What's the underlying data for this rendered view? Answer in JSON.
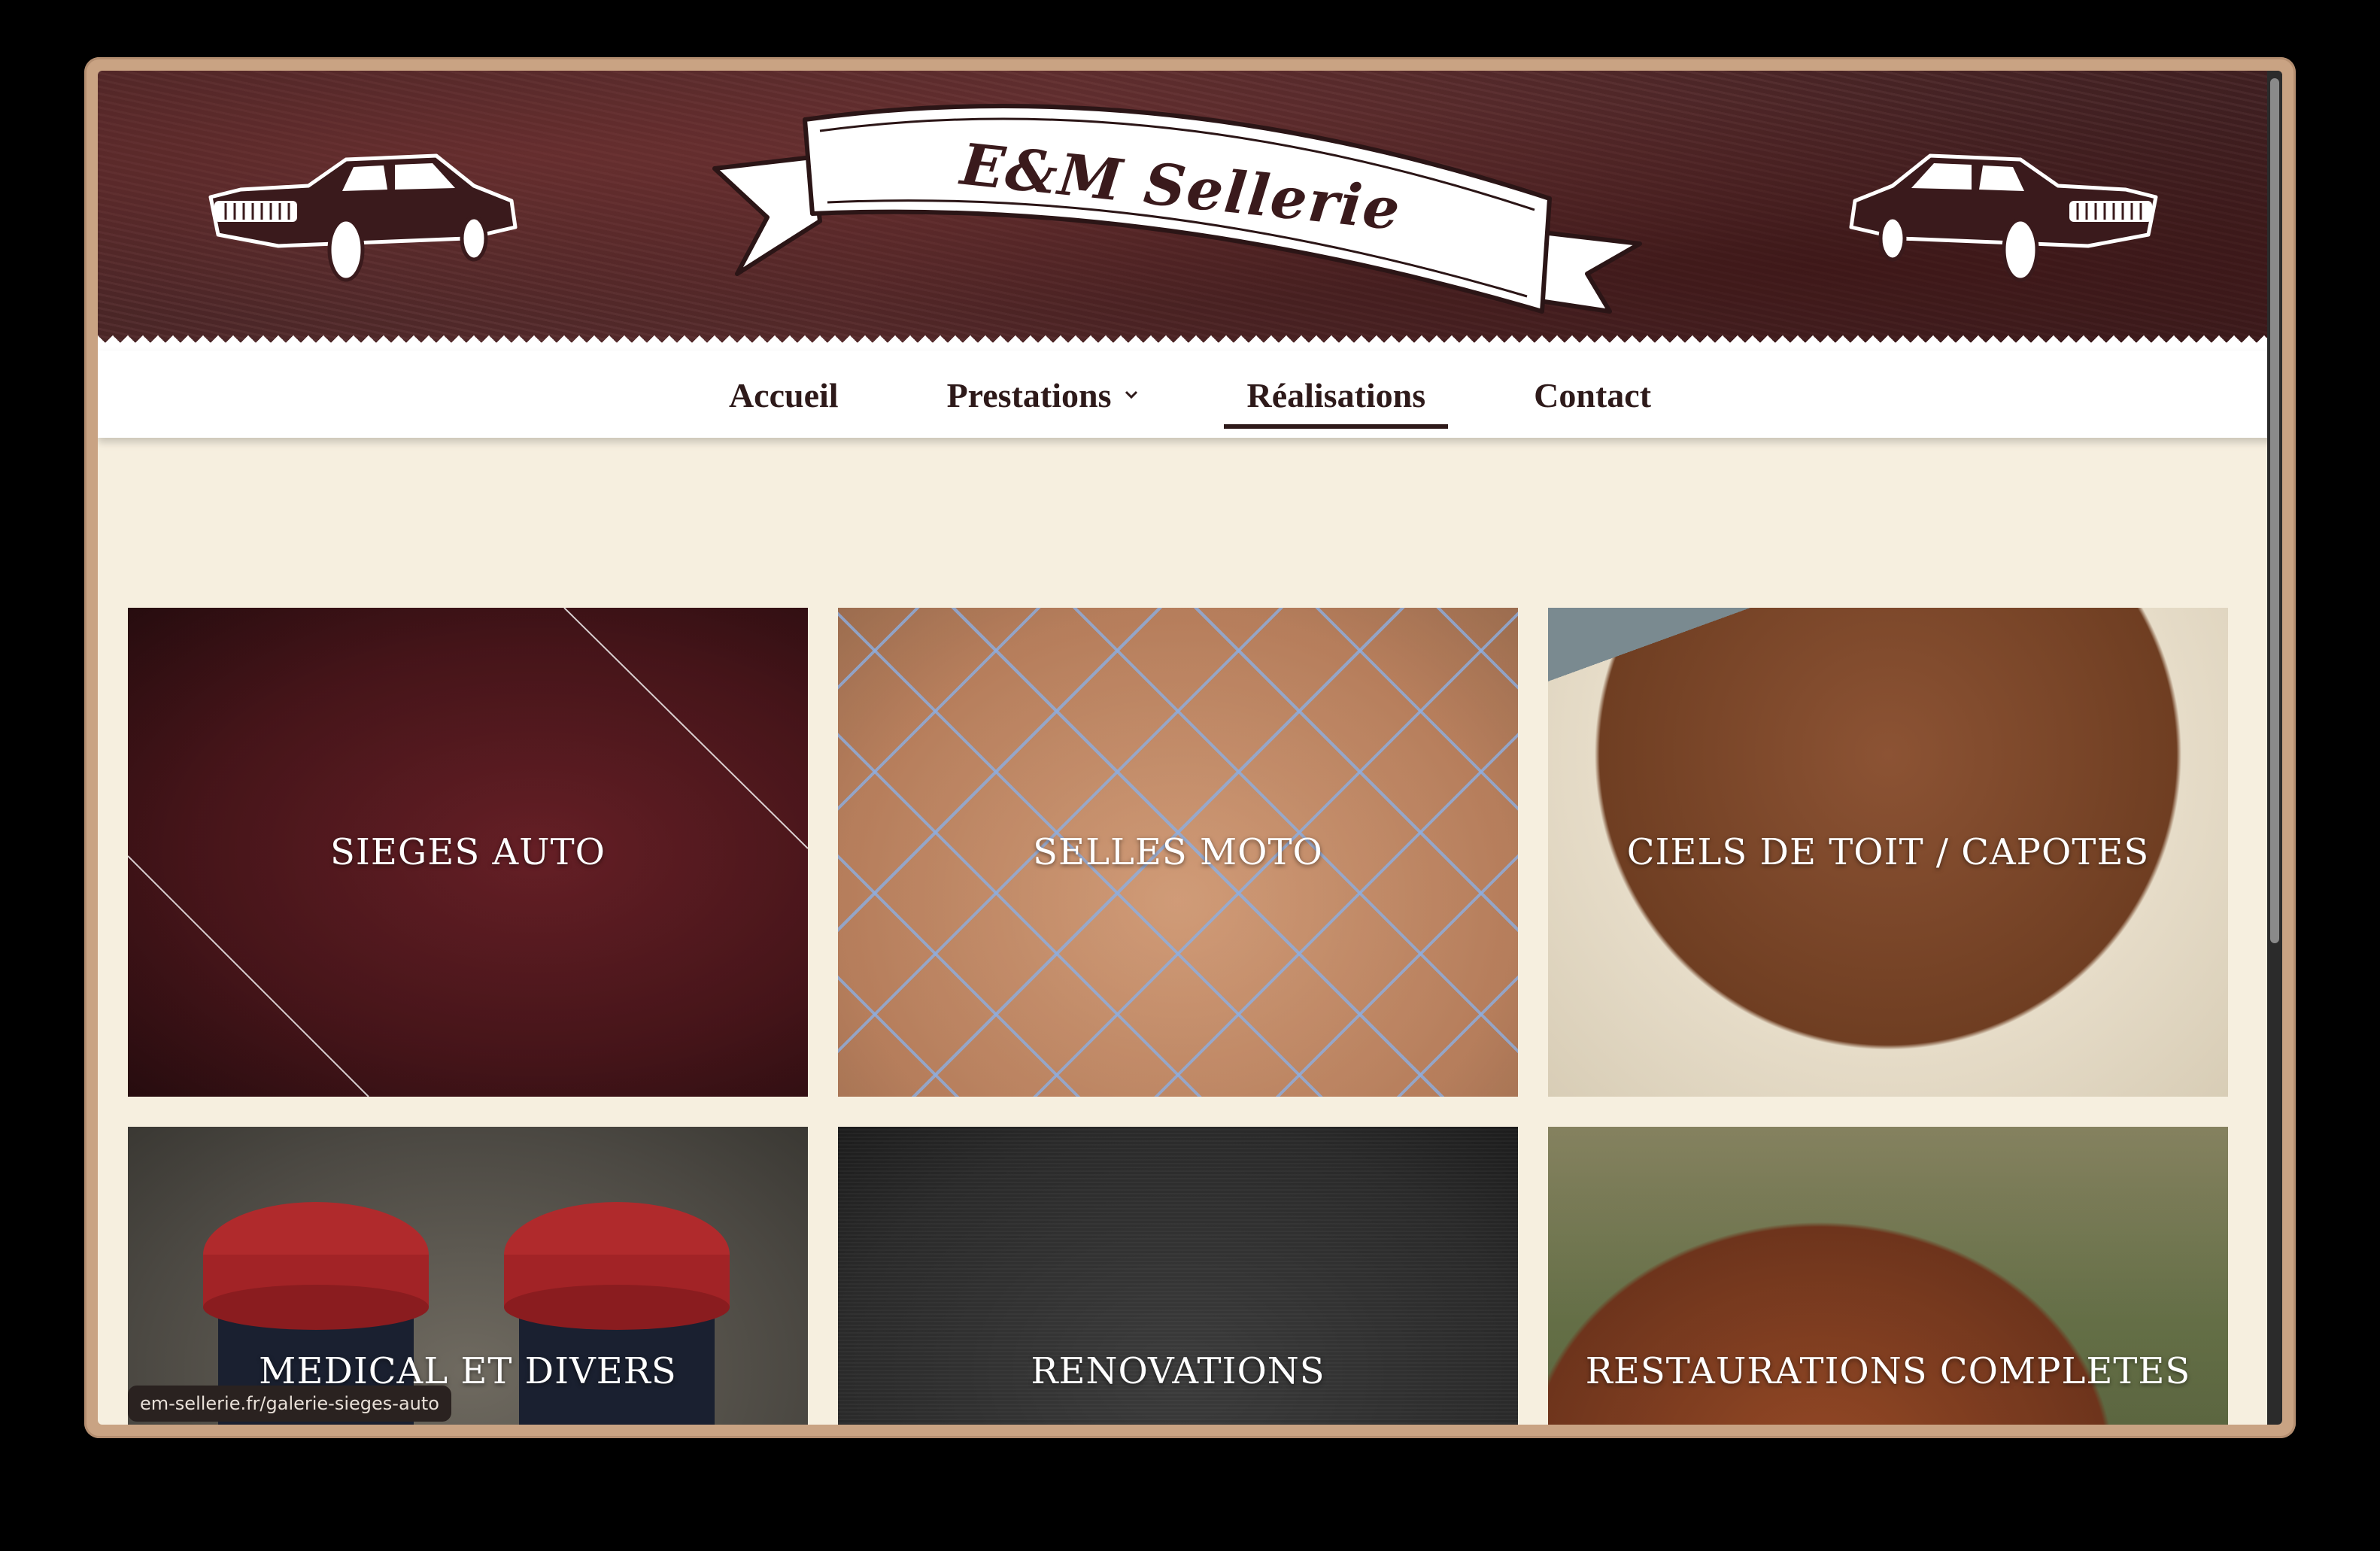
{
  "site": {
    "brand": "E&M Sellerie"
  },
  "nav": {
    "items": [
      {
        "label": "Accueil",
        "active": false,
        "dropdown": false
      },
      {
        "label": "Prestations",
        "active": false,
        "dropdown": true
      },
      {
        "label": "Réalisations",
        "active": true,
        "dropdown": false
      },
      {
        "label": "Contact",
        "active": false,
        "dropdown": false
      }
    ]
  },
  "gallery": {
    "tiles": [
      {
        "label": "SIEGES AUTO"
      },
      {
        "label": "SELLES MOTO"
      },
      {
        "label": "CIELS DE TOIT / CAPOTES"
      },
      {
        "label": "MEDICAL ET DIVERS"
      },
      {
        "label": "RENOVATIONS"
      },
      {
        "label": "RESTAURATIONS COMPLETES"
      }
    ]
  },
  "status_bar": {
    "url": "em-sellerie.fr/galerie-sieges-auto"
  },
  "colors": {
    "header_leather": "#4a2526",
    "nav_text": "#2e1a1a",
    "page_bg": "#f6efdf",
    "frame": "#c9a383"
  }
}
